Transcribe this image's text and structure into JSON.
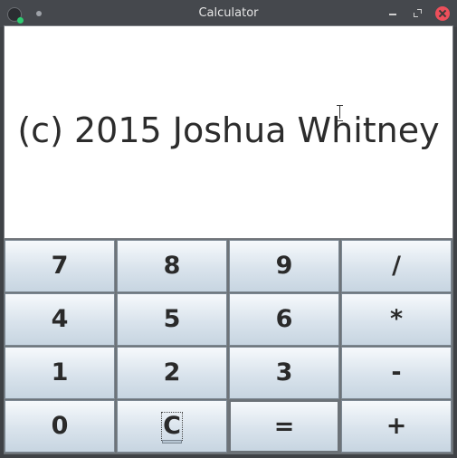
{
  "window": {
    "title": "Calculator",
    "controls": [
      "minimize",
      "maximize",
      "close"
    ]
  },
  "display": {
    "text": "(c) 2015 Joshua Whitney"
  },
  "keypad": {
    "rows": [
      [
        "7",
        "8",
        "9",
        "/"
      ],
      [
        "4",
        "5",
        "6",
        "*"
      ],
      [
        "1",
        "2",
        "3",
        "-"
      ],
      [
        "0",
        "C",
        "=",
        "+"
      ]
    ]
  },
  "colors": {
    "close_button": "#ed4f5b",
    "titlebar": "#45484d",
    "display_background": "#ffffff"
  }
}
